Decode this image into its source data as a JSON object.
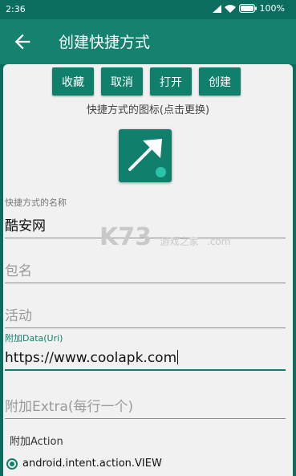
{
  "status": {
    "time": "2:36",
    "battery": "100%"
  },
  "appbar": {
    "title": "创建快捷方式"
  },
  "buttons": {
    "fav": "收藏",
    "cancel": "取消",
    "open": "打开",
    "create": "创建"
  },
  "icon_hint": "快捷方式的图标(点击更换)",
  "fields": {
    "name_label": "快捷方式的名称",
    "name_value": "酷安网",
    "package_placeholder": "包名",
    "activity_placeholder": "活动",
    "data_label": "附加Data(Uri)",
    "data_value": "https://www.coolapk.com",
    "extra_placeholder": "附加Extra(每行一个)"
  },
  "action_section": {
    "label": "附加Action",
    "selected": "android.intent.action.VIEW"
  },
  "watermark": {
    "main": "K73",
    "sub": "游戏之家",
    "domain": ".com"
  },
  "colors": {
    "primary": "#14826f",
    "dark": "#0b6d5e",
    "accent": "#10806c"
  }
}
